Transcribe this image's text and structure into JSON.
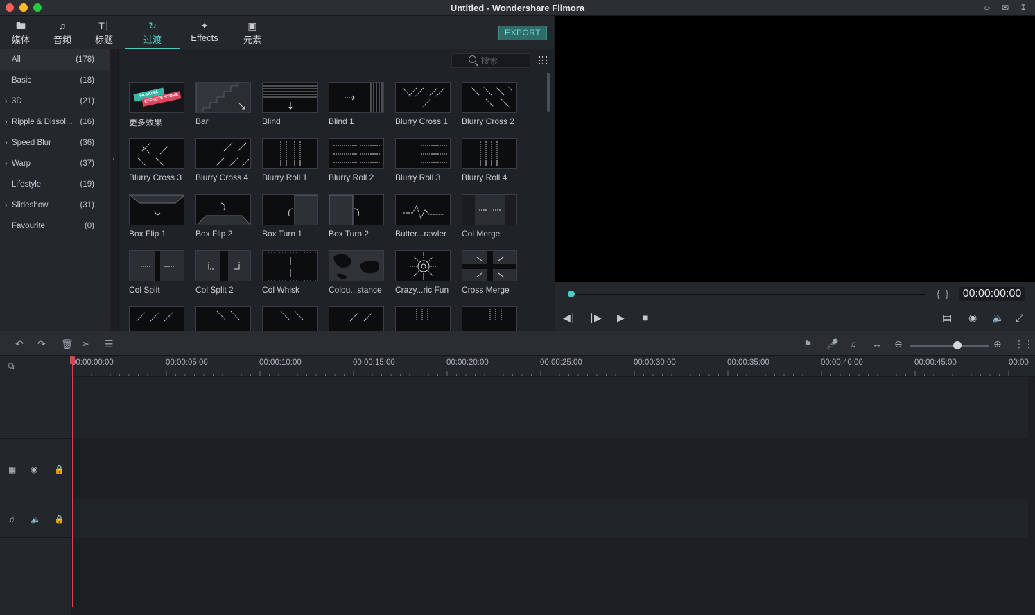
{
  "window": {
    "title": "Untitled - Wondershare Filmora"
  },
  "tabs": [
    {
      "label": "媒体",
      "icon": "folder-icon"
    },
    {
      "label": "音频",
      "icon": "music-note-icon"
    },
    {
      "label": "标题",
      "icon": "text-title-icon"
    },
    {
      "label": "过渡",
      "icon": "transition-icon"
    },
    {
      "label": "Effects",
      "icon": "effects-star-icon"
    },
    {
      "label": "元素",
      "icon": "image-element-icon"
    }
  ],
  "active_tab": "过渡",
  "export_label": "EXPORT",
  "categories": [
    {
      "name": "All",
      "count": "(178)",
      "expandable": false
    },
    {
      "name": "Basic",
      "count": "(18)",
      "expandable": false
    },
    {
      "name": "3D",
      "count": "(21)",
      "expandable": true
    },
    {
      "name": "Ripple & Dissol...",
      "count": "(16)",
      "expandable": true
    },
    {
      "name": "Speed Blur",
      "count": "(36)",
      "expandable": true
    },
    {
      "name": "Warp",
      "count": "(37)",
      "expandable": true
    },
    {
      "name": "Lifestyle",
      "count": "(19)",
      "expandable": false
    },
    {
      "name": "Slideshow",
      "count": "(31)",
      "expandable": true
    },
    {
      "name": "Favourite",
      "count": "(0)",
      "expandable": false
    }
  ],
  "search": {
    "placeholder": "搜索"
  },
  "store_badge": {
    "line1": "FILMORA",
    "line2": "EFFECTS STORE"
  },
  "transitions": [
    "更多效果",
    "Bar",
    "Blind",
    "Blind 1",
    "Blurry Cross 1",
    "Blurry Cross 2",
    "Blurry Cross 3",
    "Blurry Cross 4",
    "Blurry Roll 1",
    "Blurry Roll 2",
    "Blurry Roll 3",
    "Blurry Roll 4",
    "Box Flip 1",
    "Box Flip 2",
    "Box Turn 1",
    "Box Turn 2",
    "Butter...rawler",
    "Col Merge",
    "Col Split",
    "Col Split 2",
    "Col Whisk",
    "Colou...stance",
    "Crazy...ric Fun",
    "Cross Merge"
  ],
  "preview": {
    "timecode": "00:00:00:00",
    "progress": 0
  },
  "timeline": {
    "ruler_labels": [
      "00:00:00:00",
      "00:00:05:00",
      "00:00:10:00",
      "00:00:15:00",
      "00:00:20:00",
      "00:00:25:00",
      "00:00:30:00",
      "00:00:35:00",
      "00:00:40:00",
      "00:00:45:00",
      "00:00"
    ],
    "zoom_level": 0.6
  },
  "colors": {
    "accent": "#4ec9c4",
    "playhead": "#e0414a",
    "export_bg": "#2f6b67"
  }
}
